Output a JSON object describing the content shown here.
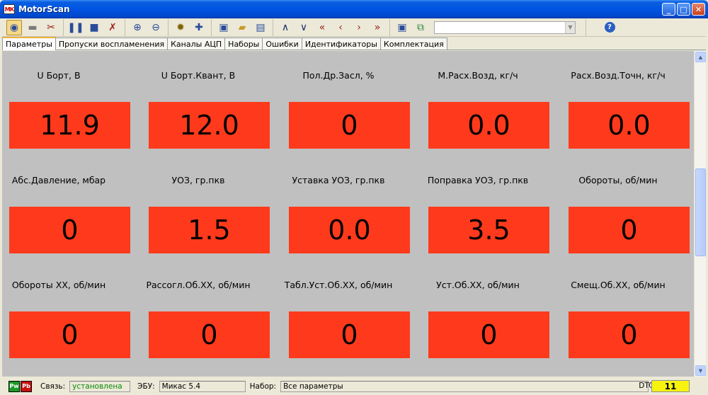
{
  "app": {
    "logo": "МК",
    "title": "MotorScan"
  },
  "window_buttons": [
    "minimize",
    "maximize",
    "close"
  ],
  "toolbar": {
    "groups": [
      [
        "connect-icon",
        "disconnect-icon",
        "tools-icon"
      ],
      [
        "pause-icon",
        "stop-icon",
        "clear-icon"
      ],
      [
        "zoom-in-icon",
        "zoom-out-icon"
      ],
      [
        "gear-wheel-icon",
        "add-icon"
      ],
      [
        "save-icon",
        "open-folder-icon",
        "export-icon"
      ],
      [
        "up-icon",
        "down-icon",
        "first-icon",
        "prev-icon",
        "next-icon",
        "last-icon"
      ],
      [
        "save-set-icon",
        "window-icon"
      ]
    ],
    "combo_value": "",
    "help_icon": "help-icon"
  },
  "tabs": [
    {
      "label": "Параметры",
      "active": true
    },
    {
      "label": "Пропуски воспламенения",
      "active": false
    },
    {
      "label": "Каналы АЦП",
      "active": false
    },
    {
      "label": "Наборы",
      "active": false
    },
    {
      "label": "Ошибки",
      "active": false
    },
    {
      "label": "Идентификаторы",
      "active": false
    },
    {
      "label": "Комплектация",
      "active": false
    }
  ],
  "params": [
    {
      "label": "U Борт, В",
      "value": "11.9"
    },
    {
      "label": "U Борт.Квант, В",
      "value": "12.0"
    },
    {
      "label": "Пол.Др.Засл, %",
      "value": "0"
    },
    {
      "label": "М.Расх.Возд, кг/ч",
      "value": "0.0"
    },
    {
      "label": "Расх.Возд.Точн, кг/ч",
      "value": "0.0"
    },
    {
      "label": "Абс.Давление, мбар",
      "value": "0"
    },
    {
      "label": "УОЗ, гр.пкв",
      "value": "1.5"
    },
    {
      "label": "Уставка УОЗ, гр.пкв",
      "value": "0.0"
    },
    {
      "label": "Поправка УОЗ, гр.пкв",
      "value": "3.5"
    },
    {
      "label": "Обороты, об/мин",
      "value": "0"
    },
    {
      "label": "Обороты ХХ, об/мин",
      "value": "0"
    },
    {
      "label": "Рассогл.Об.ХХ, об/мин",
      "value": "0"
    },
    {
      "label": "Табл.Уст.Об.ХХ, об/мин",
      "value": "0"
    },
    {
      "label": "Уст.Об.ХХ, об/мин",
      "value": "0"
    },
    {
      "label": "Смещ.Об.ХХ, об/мин",
      "value": "0"
    }
  ],
  "status": {
    "indicator_pw": "Pw",
    "indicator_pb": "Pb",
    "connection_label": "Связь:",
    "connection_value": "установлена",
    "ecu_label": "ЭБУ:",
    "ecu_value": "Микас 5.4",
    "set_label": "Набор:",
    "set_value": "Все параметры",
    "dtc_label": "DTC:",
    "dtc_value": "11"
  },
  "colors": {
    "value_box": "#ff3a1c",
    "content_bg": "#c0c0c0",
    "connection_text": "#0a8a0a",
    "dtc_bg": "#f7f30f"
  }
}
